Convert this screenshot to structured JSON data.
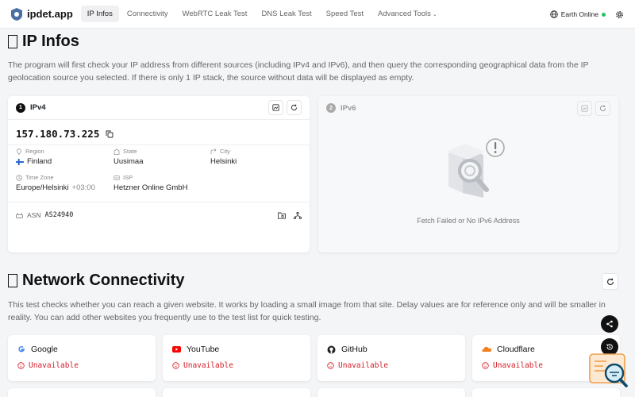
{
  "navbar": {
    "brand": "ipdet.app",
    "items": [
      "IP Infos",
      "Connectivity",
      "WebRTC Leak Test",
      "DNS Leak Test",
      "Speed Test",
      "Advanced Tools"
    ],
    "status": "Earth Online"
  },
  "ip_section": {
    "title": "IP Infos",
    "description": "The program will first check your IP address from different sources (including IPv4 and IPv6), and then query the corresponding geographical data from the IP geolocation source you selected. If there is only 1 IP stack, the source without data will be displayed as empty.",
    "ipv4": {
      "number": "1",
      "label": "IPv4",
      "ip": "157.180.73.225",
      "region_label": "Region",
      "region": "Finland",
      "state_label": "State",
      "state": "Uusimaa",
      "city_label": "City",
      "city": "Helsinki",
      "tz_label": "Time Zone",
      "tz": "Europe/Helsinki",
      "tz_offset": "+03:00",
      "isp_label": "ISP",
      "isp": "Hetzner Online GmbH",
      "asn_label": "ASN",
      "asn": "AS24940"
    },
    "ipv6": {
      "number": "2",
      "label": "IPv6",
      "message": "Fetch Failed or No IPv6 Address"
    }
  },
  "conn_section": {
    "title": "Network Connectivity",
    "description": "This test checks whether you can reach a given website. It works by loading a small image from that site. Delay values are for reference only and will be smaller in reality. You can add other websites you frequently use to the test list for quick testing.",
    "sites": [
      {
        "name": "Google",
        "status": "Unavailable"
      },
      {
        "name": "YouTube",
        "status": "Unavailable"
      },
      {
        "name": "GitHub",
        "status": "Unavailable"
      },
      {
        "name": "Cloudflare",
        "status": "Unavailable"
      }
    ]
  },
  "colors": {
    "accent_green": "#22c55e",
    "error_red": "#d0202a",
    "finland_blue": "#1b5cc7"
  },
  "icons": [
    "logo-icon",
    "globe-icon",
    "gear-icon",
    "map-icon",
    "refresh-icon",
    "copy-icon",
    "pin-icon",
    "building-icon",
    "route-icon",
    "clock-icon",
    "isp-icon",
    "router-icon",
    "folder-icon",
    "network-icon",
    "share-icon",
    "history-icon",
    "sad-face-icon"
  ]
}
